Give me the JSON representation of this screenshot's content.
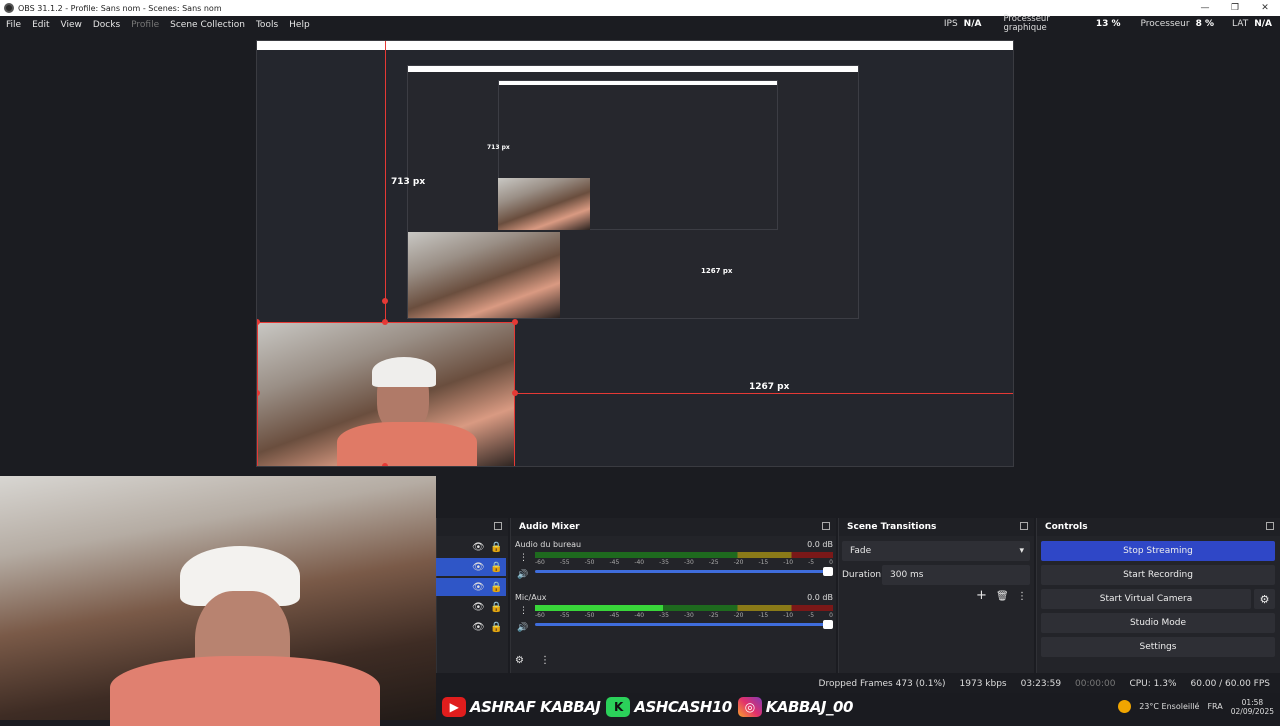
{
  "window": {
    "title": "OBS 31.1.2 - Profile: Sans nom - Scenes: Sans nom",
    "min": "—",
    "max": "❐",
    "close": "✕"
  },
  "menu": [
    "File",
    "Edit",
    "View",
    "Docks",
    "Profile",
    "Scene Collection",
    "Tools",
    "Help"
  ],
  "stats": {
    "ips_label": "IPS",
    "ips_value": "N/A",
    "gpu_label_1": "Processeur",
    "gpu_label_2": "graphique",
    "gpu_value": "13 %",
    "cpu_label": "Processeur",
    "cpu_value": "8 %",
    "lat_label": "LAT",
    "lat_value": "N/A"
  },
  "preview": {
    "height_label": "713 px",
    "width_label": "1267 px",
    "inner_width_label": "1267 px",
    "inner_height_label": "713 px"
  },
  "docks": {
    "audio_mixer": "Audio Mixer",
    "scene_transitions": "Scene Transitions",
    "controls": "Controls"
  },
  "mixer": {
    "channels": [
      {
        "name": "Audio du bureau",
        "db": "0.0 dB",
        "level": 0.0
      },
      {
        "name": "Mic/Aux",
        "db": "0.0 dB",
        "level": 0.43
      }
    ],
    "ticks": [
      "-60",
      "-55",
      "-50",
      "-45",
      "-40",
      "-35",
      "-30",
      "-25",
      "-20",
      "-15",
      "-10",
      "-5",
      "0"
    ]
  },
  "transitions": {
    "selected": "Fade",
    "duration_label": "Duration",
    "duration_value": "300 ms"
  },
  "controls": {
    "stop_streaming": "Stop Streaming",
    "start_recording": "Start Recording",
    "start_virtual_camera": "Start Virtual Camera",
    "studio_mode": "Studio Mode",
    "settings": "Settings"
  },
  "status": {
    "dropped": "Dropped Frames 473 (0.1%)",
    "bitrate": "1973 kbps",
    "stream_time": "03:23:59",
    "rec_time": "00:00:00",
    "cpu": "CPU: 1.3%",
    "fps": "60.00 / 60.00 FPS"
  },
  "overlay": {
    "youtube": "ASHRAF KABBAJ",
    "kick": "ASHCASH10",
    "instagram": "KABBAJ_00",
    "kick_letter": "K",
    "yt_icon": "▶",
    "ig_icon": "◎"
  },
  "taskbar": {
    "weather": "23°C  Ensoleillé",
    "lang": "FRA",
    "time": "01:58",
    "date": "02/09/2025"
  },
  "icons": {
    "eye": "👁",
    "lock": "🔒",
    "speaker": "🔊",
    "gear": "⚙",
    "kebab": "⋮",
    "plus": "+",
    "trash": "🗑",
    "chevron": "▾"
  }
}
